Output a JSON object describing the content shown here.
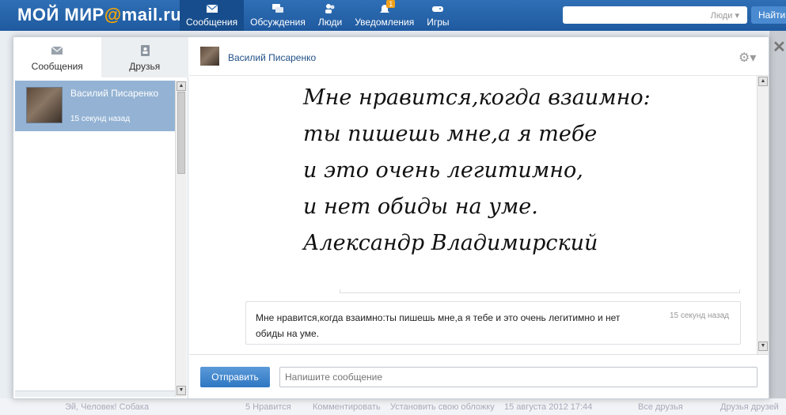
{
  "topbar": {
    "logo_left": "МОЙ МИР",
    "logo_at": "@",
    "logo_right": "mail.ru",
    "nav": [
      {
        "label": "Сообщения",
        "icon": "envelope-icon"
      },
      {
        "label": "Обсуждения",
        "icon": "speech-bubbles-icon"
      },
      {
        "label": "Люди",
        "icon": "people-icon"
      },
      {
        "label": "Уведомления",
        "icon": "bell-icon",
        "badge": "1"
      },
      {
        "label": "Игры",
        "icon": "gamepad-icon"
      }
    ],
    "search_scope": "Люди ▾",
    "search_button": "Найти"
  },
  "dialog": {
    "tabs": [
      {
        "label": "Сообщения",
        "icon": "envelope-icon",
        "active": true
      },
      {
        "label": "Друзья",
        "icon": "contacts-icon",
        "active": false
      }
    ],
    "contact": {
      "name": "Василий Писаренко",
      "time": "15 секунд назад"
    },
    "chat_head_name": "Василий Писаренко",
    "poem_lines": [
      "Мне нравится,когда взаимно:",
      "ты пишешь мне,а я тебе",
      "и это очень легитимно,",
      "и нет обиды на уме.",
      "Александр Владимирский"
    ],
    "message": {
      "text": "Мне нравится,когда взаимно:ты пишешь мне,а я тебе и это очень легитимно и нет обиды на уме.",
      "time": "15 секунд назад"
    },
    "send_label": "Отправить",
    "input_placeholder": "Напишите сообщение"
  },
  "background": {
    "left_text": "Эй, Человек! Собака",
    "likes": "5 Нравится",
    "comment": "Комментировать",
    "set_cover": "Установить свою обложку",
    "date": "15 августа 2012 17:44",
    "all_friends": "Все друзья",
    "friends_of_friends": "Друзья друзей"
  },
  "colors": {
    "topbar": "#2563a8",
    "accent": "#f7a600",
    "contact_selected": "#94b3d4",
    "send_button": "#3a82c9"
  }
}
